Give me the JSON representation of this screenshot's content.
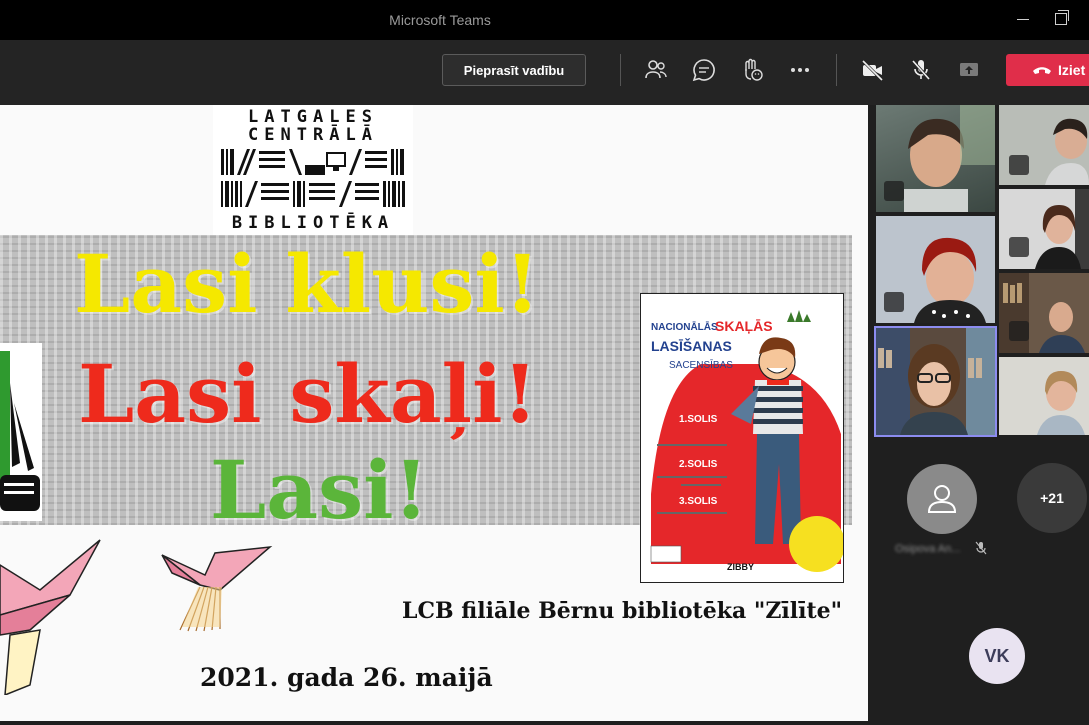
{
  "window": {
    "title": "Microsoft Teams"
  },
  "toolbar": {
    "request_control_label": "Pieprasīt vadību",
    "leave_label": "Iziet",
    "icons": [
      "people-icon",
      "chat-icon",
      "reactions-icon",
      "more-icon",
      "camera-off-icon",
      "mic-off-icon",
      "share-icon",
      "phone-hangup-icon"
    ]
  },
  "slide": {
    "logo": {
      "line1": "LATGALES",
      "line2": "CENTRĀLĀ",
      "line3": "BIBLIOTĒKA"
    },
    "headline1": "Lasi klusi!",
    "headline2": "Lasi skaļi!",
    "headline3": "Lasi!",
    "poster": {
      "title1": "NACIONĀLĀS",
      "title2": "SKAĻĀS",
      "title3": "LASĪŠANAS",
      "title4": "SACENSĪBAS",
      "stage1": "1.SOLIS",
      "stage2": "2.SOLIS",
      "stage3": "3.SOLIS",
      "badge": "ZIBBY"
    },
    "branch_line": "LCB filiāle Bērnu bibliotēka \"Zīlīte\"",
    "date_line": "2021. gada 26. maijā",
    "colors": {
      "yellow": "#f5e800",
      "red": "#ee2a1c",
      "green": "#5bb53a"
    }
  },
  "participants": {
    "overflow_count": "+21",
    "initials": "VK"
  }
}
